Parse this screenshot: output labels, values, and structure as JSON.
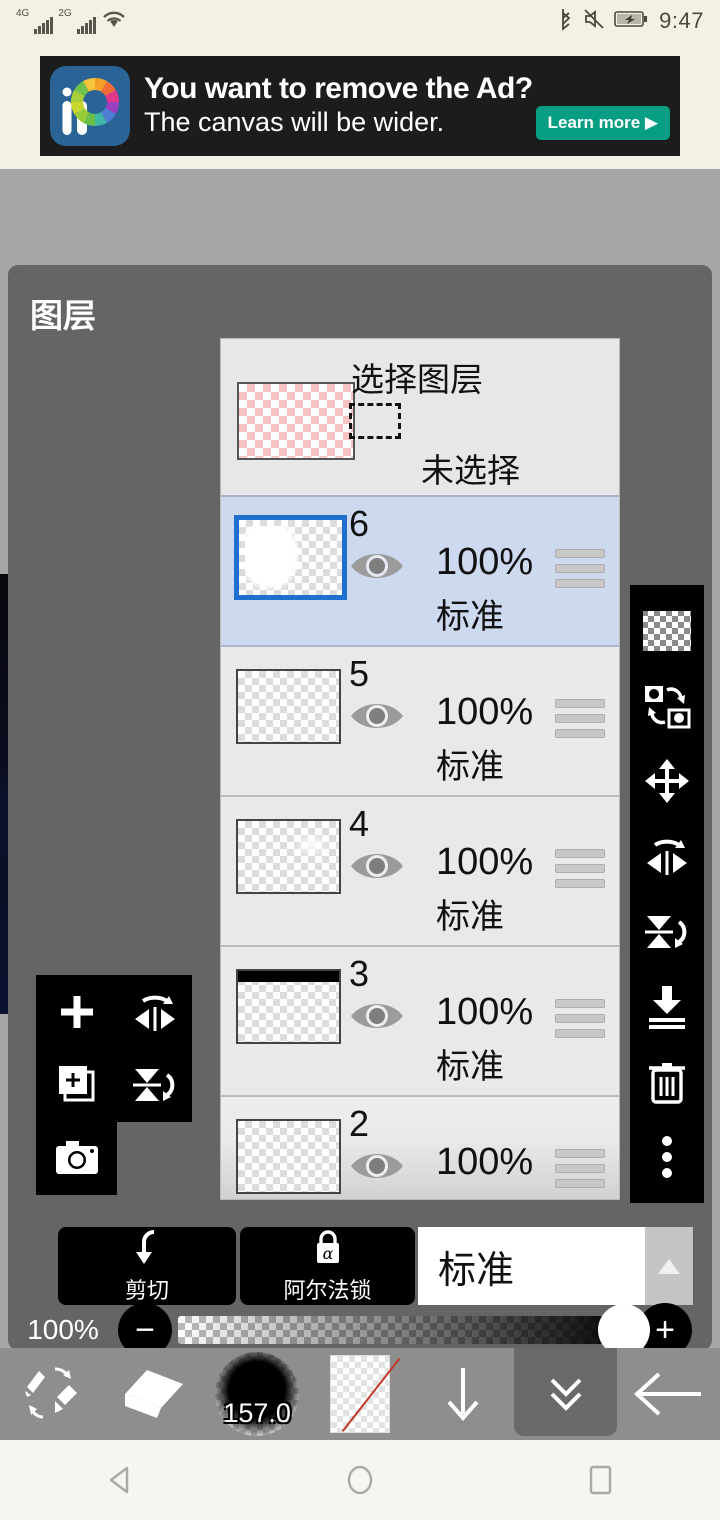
{
  "statusbar": {
    "net1": "4G",
    "net2": "2G",
    "wifi_icon": "wifi-icon",
    "bluetooth_icon": "bluetooth-icon",
    "mute_icon": "volume-mute-icon",
    "battery_icon": "battery-charging-icon",
    "time": "9:47"
  },
  "ad": {
    "logo_name": "ibispaint-logo",
    "line1": "You want to remove the Ad?",
    "line2": "The canvas will be wider.",
    "button_label": "Learn more ▶",
    "button_color": "#089e84",
    "background": "#1c1c1c"
  },
  "layer_panel": {
    "title": "图层",
    "background": "#656565"
  },
  "layer_list": {
    "header": {
      "select_layer_label": "选择图层",
      "not_selected_label": "未选择",
      "thumb_name": "selection-thumbnail",
      "marquee_name": "marquee-icon"
    },
    "rows": [
      {
        "number": "6",
        "opacity": "100%",
        "mode": "标准",
        "selected": true,
        "thumb": "blob",
        "visible": true
      },
      {
        "number": "5",
        "opacity": "100%",
        "mode": "标准",
        "selected": false,
        "thumb": "empty",
        "visible": true
      },
      {
        "number": "4",
        "opacity": "100%",
        "mode": "标准",
        "selected": false,
        "thumb": "faint",
        "visible": true
      },
      {
        "number": "3",
        "opacity": "100%",
        "mode": "标准",
        "selected": false,
        "thumb": "topbar",
        "visible": true
      },
      {
        "number": "2",
        "opacity": "100%",
        "mode": "",
        "selected": false,
        "thumb": "empty",
        "visible": true
      }
    ]
  },
  "left_tools": [
    {
      "name": "add-layer-button",
      "icon": "plus-icon"
    },
    {
      "name": "flip-horizontal-button",
      "icon": "flip-horizontal-icon"
    },
    {
      "name": "duplicate-layer-button",
      "icon": "duplicate-icon"
    },
    {
      "name": "flip-vertical-button",
      "icon": "flip-vertical-icon"
    },
    {
      "name": "camera-import-button",
      "icon": "camera-icon"
    }
  ],
  "right_tools": [
    {
      "name": "transparency-button",
      "icon": "checkerboard-icon"
    },
    {
      "name": "swap-layers-button",
      "icon": "swap-layers-icon"
    },
    {
      "name": "move-layer-button",
      "icon": "move-icon"
    },
    {
      "name": "flip-horizontal-button",
      "icon": "flip-horizontal-icon"
    },
    {
      "name": "flip-vertical-button",
      "icon": "flip-vertical-icon"
    },
    {
      "name": "merge-down-button",
      "icon": "merge-down-icon"
    },
    {
      "name": "delete-layer-button",
      "icon": "trash-icon"
    },
    {
      "name": "more-options-button",
      "icon": "more-vertical-icon"
    }
  ],
  "controls": {
    "clipping_label": "剪切",
    "clipping_icon": "clipping-arrow-icon",
    "alpha_lock_label": "阿尔法锁",
    "alpha_lock_icon": "alpha-lock-icon",
    "blend_mode_value": "标准",
    "blend_arrow_icon": "triangle-up-icon",
    "opacity_value": "100%",
    "minus_label": "−",
    "plus_label": "+"
  },
  "bottom_toolbar": {
    "items": [
      {
        "name": "brush-eraser-swap-button",
        "icon": "brush-eraser-swap-icon",
        "active": false
      },
      {
        "name": "eraser-button",
        "icon": "eraser-icon",
        "active": false
      },
      {
        "name": "brush-size-button",
        "icon": "brush-size-icon",
        "active": false,
        "value": "157.0"
      },
      {
        "name": "color-swatch-button",
        "icon": "transparent-color-icon",
        "active": false
      },
      {
        "name": "download-button",
        "icon": "arrow-down-icon",
        "active": false
      },
      {
        "name": "collapse-panel-button",
        "icon": "double-chevron-down-icon",
        "active": true
      },
      {
        "name": "back-button",
        "icon": "arrow-left-icon",
        "active": false
      }
    ]
  },
  "navbar": [
    {
      "name": "android-back-button",
      "icon": "triangle-left-icon"
    },
    {
      "name": "android-home-button",
      "icon": "circle-icon"
    },
    {
      "name": "android-recents-button",
      "icon": "square-icon"
    }
  ]
}
